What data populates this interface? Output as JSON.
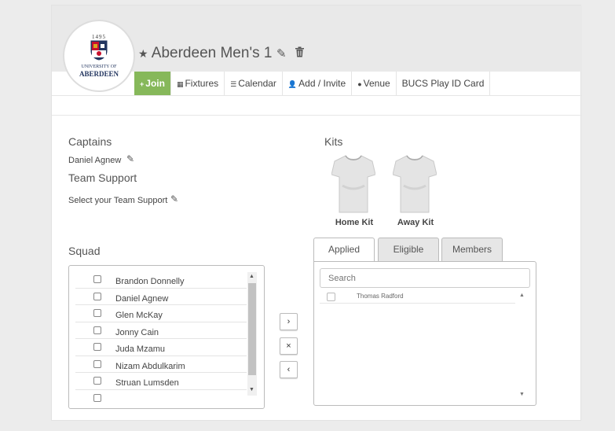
{
  "header": {
    "logo": {
      "year": "1495",
      "line1": "UNIVERSITY OF",
      "line2": "ABERDEEN",
      "colors": {
        "navy": "#22355f",
        "red": "#c8102e",
        "gold": "#d9a520"
      }
    },
    "title": "Aberdeen Men's 1",
    "star_icon": "star-icon",
    "edit_icon": "pencil-icon",
    "delete_icon": "trash-icon"
  },
  "nav": {
    "accent": "#86b85a",
    "tabs": [
      {
        "label": "Join",
        "icon": "plus-icon",
        "glyph": "+"
      },
      {
        "label": "Fixtures",
        "icon": "calendar-grid-icon",
        "glyph": "▦"
      },
      {
        "label": "Calendar",
        "icon": "list-icon",
        "glyph": "☰"
      },
      {
        "label": "Add / Invite",
        "icon": "add-user-icon",
        "glyph": "👤"
      },
      {
        "label": "Venue",
        "icon": "map-marker-icon",
        "glyph": "●"
      },
      {
        "label": "BUCS Play ID Card",
        "icon": "",
        "glyph": ""
      }
    ]
  },
  "captains": {
    "heading": "Captains",
    "name": "Daniel Agnew"
  },
  "team_support": {
    "heading": "Team Support",
    "placeholder": "Select your Team Support"
  },
  "kits": {
    "heading": "Kits",
    "items": [
      {
        "label": "Home Kit"
      },
      {
        "label": "Away Kit"
      }
    ]
  },
  "squad": {
    "heading": "Squad",
    "members": [
      "Brandon Donnelly",
      "Daniel Agnew",
      "Glen McKay",
      "Jonny Cain",
      "Juda Mzamu",
      "Nizam Abdulkarim",
      "Struan Lumsden"
    ]
  },
  "transfer_buttons": {
    "add": "›",
    "remove": "×",
    "back": "‹"
  },
  "right_panel": {
    "tabs": [
      "Applied",
      "Eligible",
      "Members"
    ],
    "active_tab": "Applied",
    "search_placeholder": "Search",
    "rows": [
      "Thomas Radford"
    ]
  }
}
